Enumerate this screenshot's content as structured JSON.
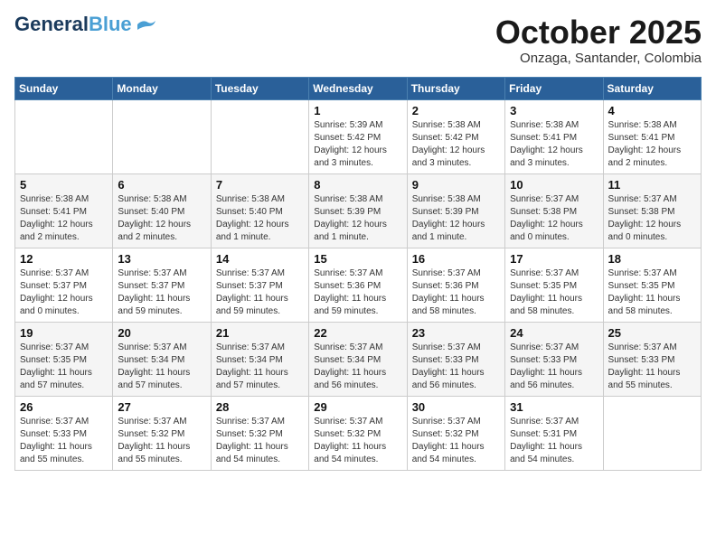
{
  "header": {
    "logo_general": "General",
    "logo_blue": "Blue",
    "month_title": "October 2025",
    "location": "Onzaga, Santander, Colombia"
  },
  "days_of_week": [
    "Sunday",
    "Monday",
    "Tuesday",
    "Wednesday",
    "Thursday",
    "Friday",
    "Saturday"
  ],
  "weeks": [
    [
      {
        "day": "",
        "info": ""
      },
      {
        "day": "",
        "info": ""
      },
      {
        "day": "",
        "info": ""
      },
      {
        "day": "1",
        "info": "Sunrise: 5:39 AM\nSunset: 5:42 PM\nDaylight: 12 hours\nand 3 minutes."
      },
      {
        "day": "2",
        "info": "Sunrise: 5:38 AM\nSunset: 5:42 PM\nDaylight: 12 hours\nand 3 minutes."
      },
      {
        "day": "3",
        "info": "Sunrise: 5:38 AM\nSunset: 5:41 PM\nDaylight: 12 hours\nand 3 minutes."
      },
      {
        "day": "4",
        "info": "Sunrise: 5:38 AM\nSunset: 5:41 PM\nDaylight: 12 hours\nand 2 minutes."
      }
    ],
    [
      {
        "day": "5",
        "info": "Sunrise: 5:38 AM\nSunset: 5:41 PM\nDaylight: 12 hours\nand 2 minutes."
      },
      {
        "day": "6",
        "info": "Sunrise: 5:38 AM\nSunset: 5:40 PM\nDaylight: 12 hours\nand 2 minutes."
      },
      {
        "day": "7",
        "info": "Sunrise: 5:38 AM\nSunset: 5:40 PM\nDaylight: 12 hours\nand 1 minute."
      },
      {
        "day": "8",
        "info": "Sunrise: 5:38 AM\nSunset: 5:39 PM\nDaylight: 12 hours\nand 1 minute."
      },
      {
        "day": "9",
        "info": "Sunrise: 5:38 AM\nSunset: 5:39 PM\nDaylight: 12 hours\nand 1 minute."
      },
      {
        "day": "10",
        "info": "Sunrise: 5:37 AM\nSunset: 5:38 PM\nDaylight: 12 hours\nand 0 minutes."
      },
      {
        "day": "11",
        "info": "Sunrise: 5:37 AM\nSunset: 5:38 PM\nDaylight: 12 hours\nand 0 minutes."
      }
    ],
    [
      {
        "day": "12",
        "info": "Sunrise: 5:37 AM\nSunset: 5:37 PM\nDaylight: 12 hours\nand 0 minutes."
      },
      {
        "day": "13",
        "info": "Sunrise: 5:37 AM\nSunset: 5:37 PM\nDaylight: 11 hours\nand 59 minutes."
      },
      {
        "day": "14",
        "info": "Sunrise: 5:37 AM\nSunset: 5:37 PM\nDaylight: 11 hours\nand 59 minutes."
      },
      {
        "day": "15",
        "info": "Sunrise: 5:37 AM\nSunset: 5:36 PM\nDaylight: 11 hours\nand 59 minutes."
      },
      {
        "day": "16",
        "info": "Sunrise: 5:37 AM\nSunset: 5:36 PM\nDaylight: 11 hours\nand 58 minutes."
      },
      {
        "day": "17",
        "info": "Sunrise: 5:37 AM\nSunset: 5:35 PM\nDaylight: 11 hours\nand 58 minutes."
      },
      {
        "day": "18",
        "info": "Sunrise: 5:37 AM\nSunset: 5:35 PM\nDaylight: 11 hours\nand 58 minutes."
      }
    ],
    [
      {
        "day": "19",
        "info": "Sunrise: 5:37 AM\nSunset: 5:35 PM\nDaylight: 11 hours\nand 57 minutes."
      },
      {
        "day": "20",
        "info": "Sunrise: 5:37 AM\nSunset: 5:34 PM\nDaylight: 11 hours\nand 57 minutes."
      },
      {
        "day": "21",
        "info": "Sunrise: 5:37 AM\nSunset: 5:34 PM\nDaylight: 11 hours\nand 57 minutes."
      },
      {
        "day": "22",
        "info": "Sunrise: 5:37 AM\nSunset: 5:34 PM\nDaylight: 11 hours\nand 56 minutes."
      },
      {
        "day": "23",
        "info": "Sunrise: 5:37 AM\nSunset: 5:33 PM\nDaylight: 11 hours\nand 56 minutes."
      },
      {
        "day": "24",
        "info": "Sunrise: 5:37 AM\nSunset: 5:33 PM\nDaylight: 11 hours\nand 56 minutes."
      },
      {
        "day": "25",
        "info": "Sunrise: 5:37 AM\nSunset: 5:33 PM\nDaylight: 11 hours\nand 55 minutes."
      }
    ],
    [
      {
        "day": "26",
        "info": "Sunrise: 5:37 AM\nSunset: 5:33 PM\nDaylight: 11 hours\nand 55 minutes."
      },
      {
        "day": "27",
        "info": "Sunrise: 5:37 AM\nSunset: 5:32 PM\nDaylight: 11 hours\nand 55 minutes."
      },
      {
        "day": "28",
        "info": "Sunrise: 5:37 AM\nSunset: 5:32 PM\nDaylight: 11 hours\nand 54 minutes."
      },
      {
        "day": "29",
        "info": "Sunrise: 5:37 AM\nSunset: 5:32 PM\nDaylight: 11 hours\nand 54 minutes."
      },
      {
        "day": "30",
        "info": "Sunrise: 5:37 AM\nSunset: 5:32 PM\nDaylight: 11 hours\nand 54 minutes."
      },
      {
        "day": "31",
        "info": "Sunrise: 5:37 AM\nSunset: 5:31 PM\nDaylight: 11 hours\nand 54 minutes."
      },
      {
        "day": "",
        "info": ""
      }
    ]
  ]
}
